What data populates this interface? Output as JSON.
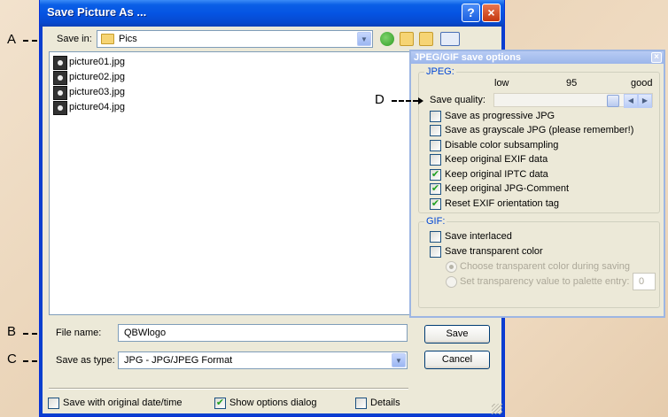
{
  "callouts": {
    "a": "A",
    "b": "B",
    "c": "C",
    "d": "D"
  },
  "dialog": {
    "title": "Save Picture As ...",
    "help_icon": "?",
    "close_icon": "×",
    "save_in_label": "Save in:",
    "save_in_value": "Pics",
    "files": [
      "picture01.jpg",
      "picture02.jpg",
      "picture03.jpg",
      "picture04.jpg"
    ],
    "file_name_label": "File name:",
    "file_name_value": "QBWlogo",
    "save_as_type_label": "Save as type:",
    "save_as_type_value": "JPG - JPG/JPEG Format",
    "save_button": "Save",
    "cancel_button": "Cancel",
    "bottom_options": [
      {
        "label": "Save with original date/time",
        "checked": false
      },
      {
        "label": "Show options dialog",
        "checked": true
      },
      {
        "label": "Details",
        "checked": false
      }
    ]
  },
  "options_panel": {
    "title": "JPEG/GIF save options",
    "close_icon": "×",
    "jpeg_group": "JPEG:",
    "quality_low": "low",
    "quality_value": "95",
    "quality_good": "good",
    "save_quality_label": "Save quality:",
    "quality_fraction": 0.95,
    "jpeg_options": [
      {
        "label": "Save as progressive JPG",
        "checked": false
      },
      {
        "label": "Save as grayscale JPG (please remember!)",
        "checked": false
      },
      {
        "label": "Disable color subsampling",
        "checked": false
      },
      {
        "label": "Keep original EXIF data",
        "checked": false
      },
      {
        "label": "Keep original IPTC data",
        "checked": true
      },
      {
        "label": "Keep original JPG-Comment",
        "checked": true
      },
      {
        "label": "Reset EXIF orientation tag",
        "checked": true
      }
    ],
    "gif_group": "GIF:",
    "gif_options": [
      {
        "label": "Save interlaced",
        "checked": false
      },
      {
        "label": "Save transparent color",
        "checked": false
      }
    ],
    "transparent_radios": [
      {
        "label": "Choose transparent color during saving",
        "selected": true
      },
      {
        "label": "Set transparency value to palette entry:",
        "selected": false
      }
    ],
    "palette_entry_value": "0"
  },
  "icons": {
    "check": "✔",
    "drop": "▼",
    "left": "◀",
    "right": "▶"
  }
}
